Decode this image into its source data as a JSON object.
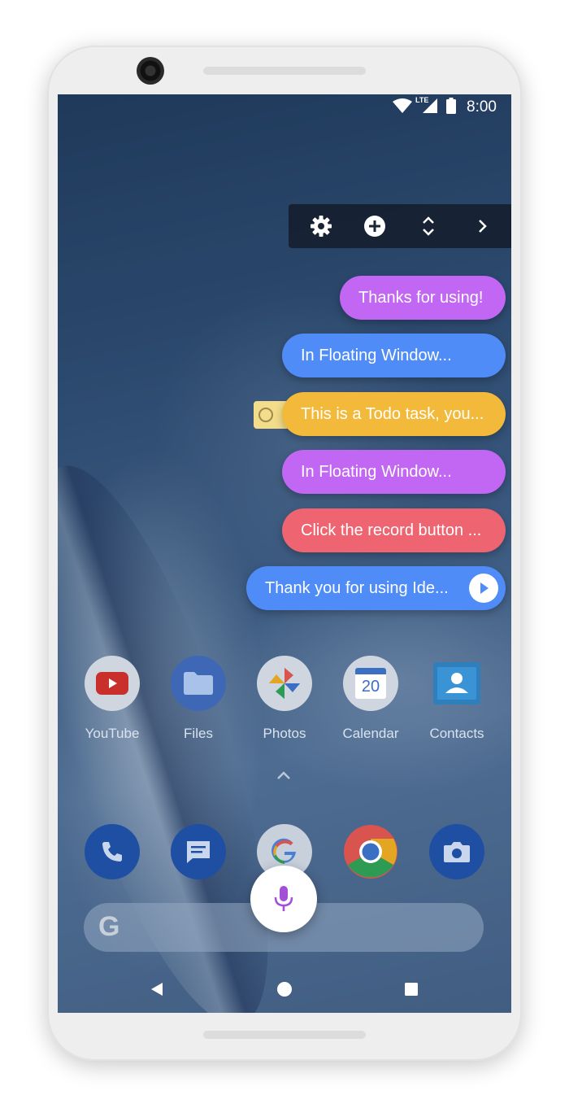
{
  "status_bar": {
    "time": "8:00",
    "network": "LTE"
  },
  "floating_toolbar": {
    "icons": [
      "gear-icon",
      "add-circle-icon",
      "expand-collapse-icon",
      "chevron-right-icon"
    ]
  },
  "bubbles": [
    {
      "text": "Thanks for using!",
      "color": "#c266f4"
    },
    {
      "text": "In Floating Window...",
      "color": "#4f8cf7"
    },
    {
      "text": "This is a Todo task, you...",
      "color": "#f3b93a"
    },
    {
      "text": "In Floating Window...",
      "color": "#c266f4"
    },
    {
      "text": "Click the record button ...",
      "color": "#ef6471"
    },
    {
      "text": "Thank you for using Ide...",
      "color": "#4f8cf7"
    }
  ],
  "home_apps": [
    {
      "label": "YouTube"
    },
    {
      "label": "Files"
    },
    {
      "label": "Photos"
    },
    {
      "label": "Calendar",
      "date": "20"
    },
    {
      "label": "Contacts"
    }
  ],
  "dock_apps": [
    "phone-icon",
    "messages-icon",
    "google-icon",
    "chrome-icon",
    "camera-icon"
  ],
  "search": {
    "logo": "G"
  },
  "nav_icons": [
    "back-icon",
    "home-icon",
    "recents-icon"
  ]
}
